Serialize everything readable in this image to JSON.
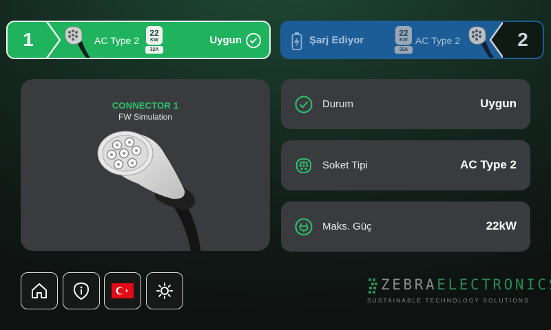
{
  "connector_tabs": [
    {
      "number": "1",
      "connector_type": "AC Type 2",
      "power_value": "22",
      "power_unit": "KW",
      "current": "32A",
      "status": "Uygun",
      "active": true,
      "color": "#1fb35e"
    },
    {
      "number": "2",
      "status": "Şarj Ediyor",
      "connector_type": "AC Type 2",
      "power_value": "22",
      "power_unit": "KW",
      "current": "32A",
      "active": false,
      "color": "#1d5d97"
    }
  ],
  "connector_card": {
    "title": "CONNECTOR 1",
    "subtitle": "FW Simulation"
  },
  "info_rows": [
    {
      "label": "Durum",
      "value": "Uygun",
      "icon": "check-circle-icon"
    },
    {
      "label": "Soket Tipi",
      "value": "AC Type 2",
      "icon": "socket-icon"
    },
    {
      "label": "Maks. Güç",
      "value": "22kW",
      "icon": "power-plug-icon"
    }
  ],
  "bottom_buttons": [
    {
      "icon": "home-icon"
    },
    {
      "icon": "info-icon"
    },
    {
      "icon": "turkey-flag-icon"
    },
    {
      "icon": "brightness-icon"
    }
  ],
  "logo": {
    "brand_part1": "ZEBRA",
    "brand_part2": "ELECTRONICS",
    "tagline": "SUSTAINABLE TECHNOLOGY SOLUTIONS"
  },
  "colors": {
    "accent_green": "#1fb35e",
    "charging_blue": "#1d5d97",
    "card_bg": "#3a3b3e",
    "highlight_green": "#2bc46b"
  }
}
